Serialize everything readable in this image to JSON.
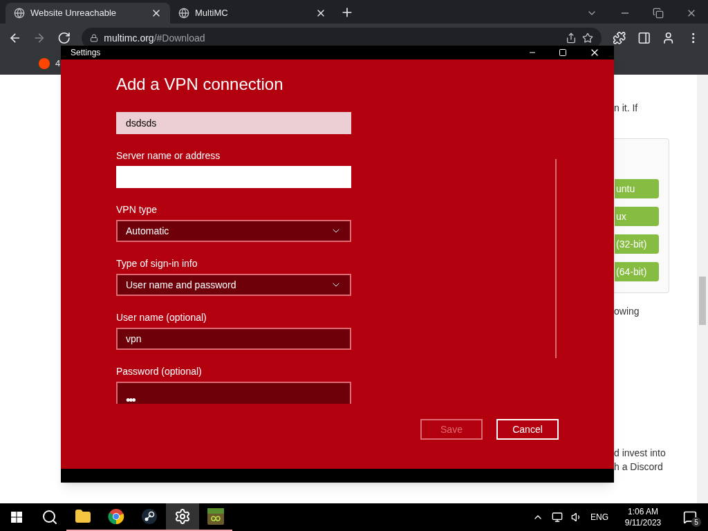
{
  "browser": {
    "tabs": [
      {
        "title": "Website Unreachable",
        "selected": true
      },
      {
        "title": "MultiMC",
        "selected": false
      }
    ],
    "address": {
      "domain": "multimc.org",
      "path": "/#Download"
    },
    "bookmarks": [
      {
        "label": "4"
      }
    ]
  },
  "page": {
    "texts": [
      "n it. If",
      "owing",
      "d invest into",
      "h a Discord"
    ],
    "buttons": [
      "untu",
      "ux",
      "(32-bit)",
      "(64-bit)"
    ]
  },
  "dialog": {
    "title": "Settings",
    "heading": "Add a VPN connection",
    "fields": [
      {
        "kind": "textbox",
        "value": "dsdsds",
        "highlighted": true,
        "focused": false
      },
      {
        "kind": "textbox",
        "label": "Server name or address",
        "highlighted": false,
        "focused": true
      },
      {
        "kind": "dropdown",
        "label": "VPN type",
        "value": "Automatic",
        "highlighted": false,
        "focused": false
      },
      {
        "kind": "dropdown",
        "label": "Type of sign-in info",
        "value": "User name and password",
        "highlighted": false,
        "focused": false
      },
      {
        "kind": "textbox",
        "label": "User name (optional)",
        "value": "vpn",
        "highlighted": false,
        "focused": false
      },
      {
        "kind": "password",
        "label": "Password (optional)",
        "value": "•••",
        "highlighted": false,
        "focused": false
      }
    ],
    "buttons": [
      {
        "label": "Save",
        "disabled": true
      },
      {
        "label": "Cancel",
        "disabled": false
      }
    ]
  },
  "taskbar": {
    "apps": [
      {
        "kind": "folder",
        "selected": false
      },
      {
        "kind": "chrome",
        "selected": false
      },
      {
        "kind": "steam",
        "selected": false
      },
      {
        "kind": "settings",
        "selected": true
      },
      {
        "kind": "minecraft",
        "selected": false
      }
    ],
    "language": "ENG",
    "time": "1:06 AM",
    "date": "9/11/2023",
    "notifications": "5"
  }
}
